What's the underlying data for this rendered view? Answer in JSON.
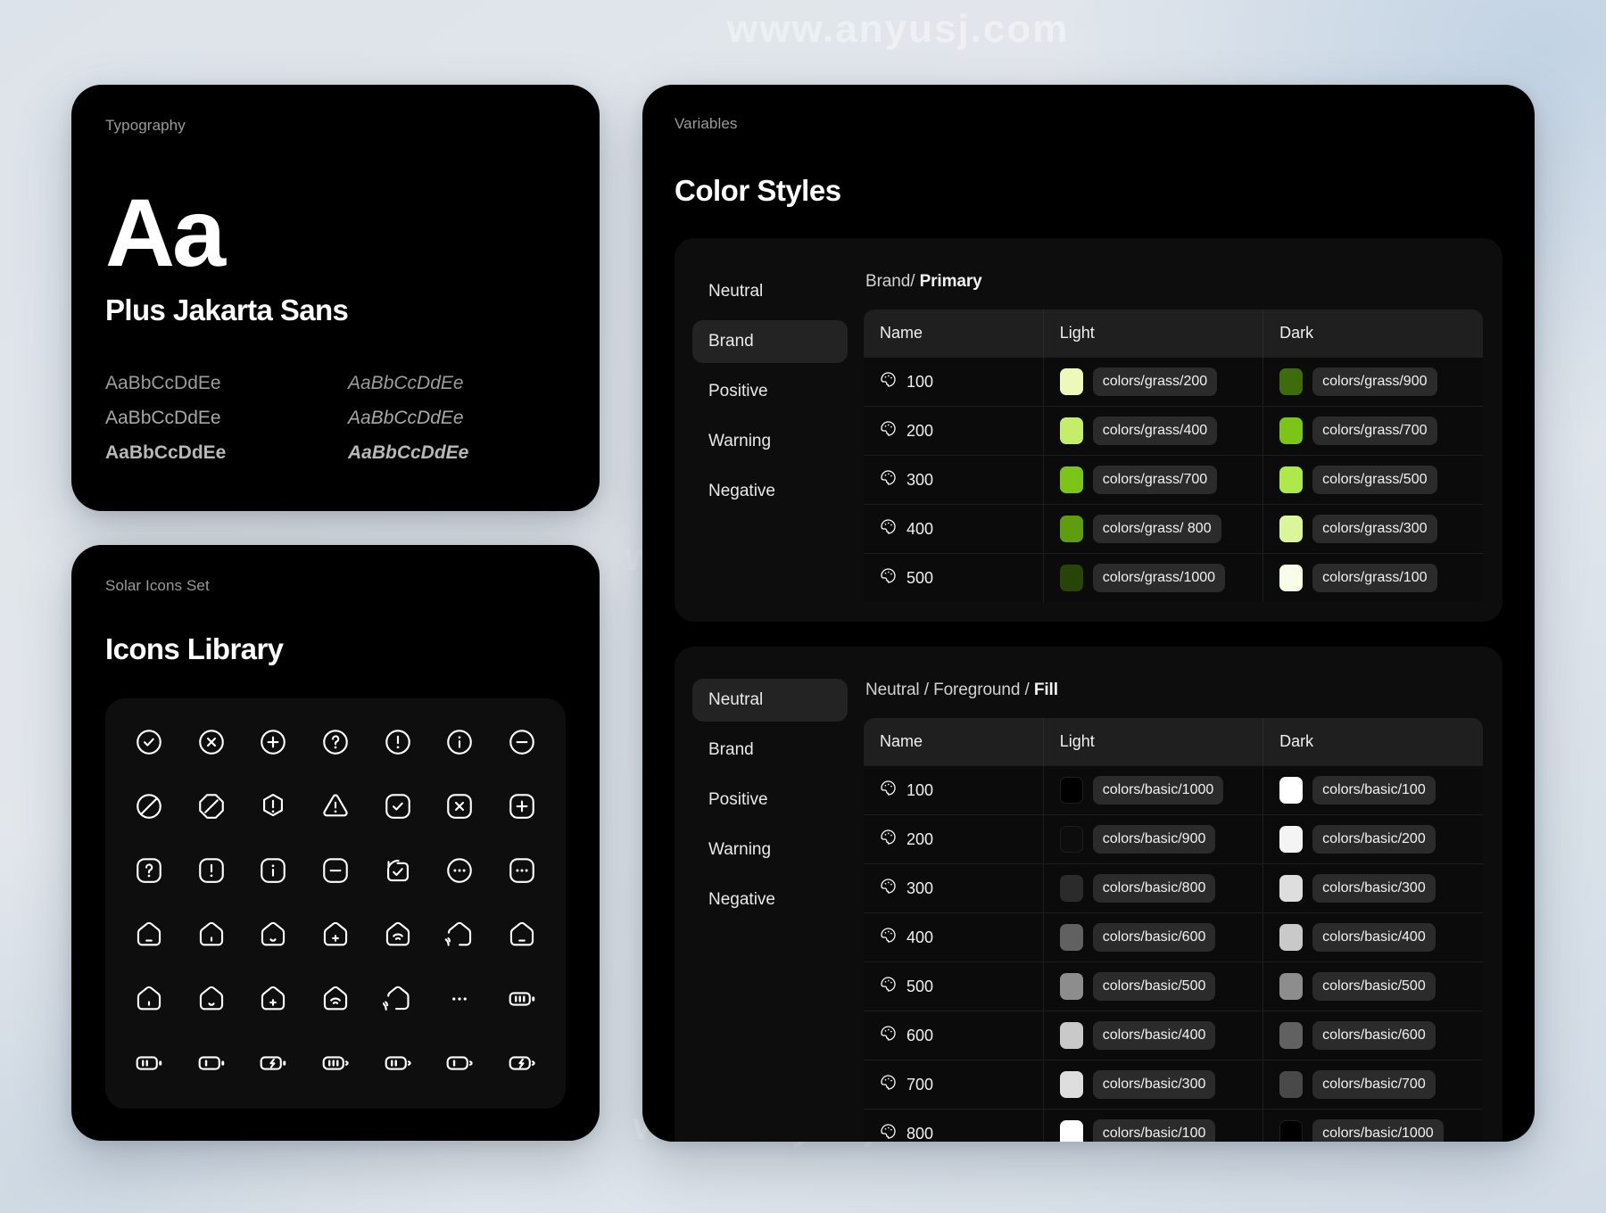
{
  "watermarks": [
    "www.anyusj.com",
    "www.anyusj.com",
    "www.anyusj.com"
  ],
  "typography": {
    "eyebrow": "Typography",
    "glyph": "Aa",
    "font_name": "Plus Jakarta Sans",
    "specimens": [
      {
        "roman": "AaBbCcDdEe",
        "italic": "AaBbCcDdEe"
      },
      {
        "roman": "AaBbCcDdEe",
        "italic": "AaBbCcDdEe"
      },
      {
        "roman": "AaBbCcDdEe",
        "italic": "AaBbCcDdEe"
      }
    ]
  },
  "icons": {
    "eyebrow": "Solar Icons Set",
    "title": "Icons Library",
    "grid": [
      "check-circle-icon",
      "close-circle-icon",
      "add-circle-icon",
      "question-circle-icon",
      "danger-circle-icon",
      "info-circle-icon",
      "minus-circle-icon",
      "forbidden-circle-icon",
      "forbidden-octagon-icon",
      "danger-hexagon-icon",
      "danger-triangle-icon",
      "check-square-icon",
      "close-square-icon",
      "add-square-icon",
      "question-square-icon",
      "danger-square-icon",
      "info-square-icon",
      "minus-square-icon",
      "undo-check-icon",
      "menu-dots-circle-icon",
      "menu-dots-square-icon",
      "home-icon",
      "home-angle-icon",
      "home-smile-icon",
      "home-add-icon",
      "home-wifi-icon",
      "home-wifi-angle-icon",
      "home-2-icon",
      "home-angle-2-icon",
      "home-smile-angle-icon",
      "home-add-angle-icon",
      "home-wifi-2-icon",
      "home-wifi-angle-2-icon",
      "menu-dots-icon",
      "battery-full-minimalistic-icon",
      "battery-half-minimalistic-icon",
      "battery-low-minimalistic-icon",
      "battery-charge-minimalistic-icon",
      "battery-full-icon",
      "battery-half-icon",
      "battery-low-icon",
      "battery-charge-icon"
    ]
  },
  "variables": {
    "eyebrow": "Variables",
    "title": "Color Styles",
    "tables": [
      {
        "id": "brand-table",
        "nav": [
          "Neutral",
          "Brand",
          "Positive",
          "Warning",
          "Negative"
        ],
        "active_nav": "Brand",
        "breadcrumb_prefix": "Brand/ ",
        "breadcrumb_current": "Primary",
        "columns": [
          "Name",
          "Light",
          "Dark"
        ],
        "rows": [
          {
            "name": "100",
            "light_token": "colors/grass/200",
            "light_hex": "#edf9b9",
            "dark_token": "colors/grass/900",
            "dark_hex": "#3e6b0c"
          },
          {
            "name": "200",
            "light_token": "colors/grass/400",
            "light_hex": "#c4ee69",
            "dark_token": "colors/grass/700",
            "dark_hex": "#7cc418"
          },
          {
            "name": "300",
            "light_token": "colors/grass/700",
            "light_hex": "#7cc418",
            "dark_token": "colors/grass/500",
            "dark_hex": "#aee84a"
          },
          {
            "name": "400",
            "light_token": "colors/grass/ 800",
            "light_hex": "#5e9c10",
            "dark_token": "colors/grass/300",
            "dark_hex": "#dbf59a"
          },
          {
            "name": "500",
            "light_token": "colors/grass/1000",
            "light_hex": "#274508",
            "dark_token": "colors/grass/100",
            "dark_hex": "#f7fde6"
          }
        ]
      },
      {
        "id": "neutral-table",
        "nav": [
          "Neutral",
          "Brand",
          "Positive",
          "Warning",
          "Negative"
        ],
        "active_nav": "Neutral",
        "breadcrumb_prefix": "Neutral / Foreground / ",
        "breadcrumb_current": "Fill",
        "columns": [
          "Name",
          "Light",
          "Dark"
        ],
        "rows": [
          {
            "name": "100",
            "light_token": "colors/basic/1000",
            "light_hex": "#000000",
            "dark_token": "colors/basic/100",
            "dark_hex": "#ffffff"
          },
          {
            "name": "200",
            "light_token": "colors/basic/900",
            "light_hex": "#0d0d0d",
            "dark_token": "colors/basic/200",
            "dark_hex": "#f4f4f4"
          },
          {
            "name": "300",
            "light_token": "colors/basic/800",
            "light_hex": "#2b2b2b",
            "dark_token": "colors/basic/300",
            "dark_hex": "#dededf"
          },
          {
            "name": "400",
            "light_token": "colors/basic/600",
            "light_hex": "#616162",
            "dark_token": "colors/basic/400",
            "dark_hex": "#c9c9ca"
          },
          {
            "name": "500",
            "light_token": "colors/basic/500",
            "light_hex": "#8d8d8e",
            "dark_token": "colors/basic/500",
            "dark_hex": "#8d8d8e"
          },
          {
            "name": "600",
            "light_token": "colors/basic/400",
            "light_hex": "#c9c9ca",
            "dark_token": "colors/basic/600",
            "dark_hex": "#616162"
          },
          {
            "name": "700",
            "light_token": "colors/basic/300",
            "light_hex": "#dededf",
            "dark_token": "colors/basic/700",
            "dark_hex": "#494949"
          },
          {
            "name": "800",
            "light_token": "colors/basic/100",
            "light_hex": "#ffffff",
            "dark_token": "colors/basic/1000",
            "dark_hex": "#000000"
          }
        ]
      }
    ]
  },
  "palette_icon": "palette-icon"
}
